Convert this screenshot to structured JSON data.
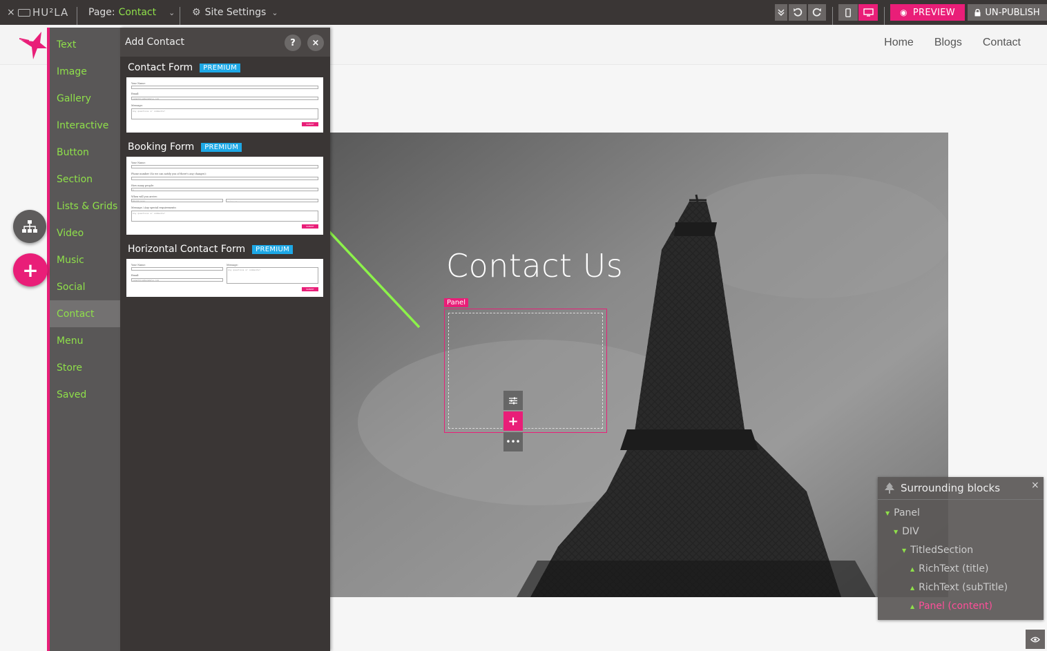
{
  "topbar": {
    "close": "×",
    "logo": "HU²LA",
    "page_label": "Page:",
    "page_value": "Contact",
    "site_settings": "Site Settings",
    "preview": "PREVIEW",
    "unpublish": "UN-PUBLISH",
    "chevron": "v"
  },
  "site": {
    "nav": [
      "Home",
      "Blogs",
      "Contact"
    ],
    "hero_title": "Contact Us",
    "panel_tag": "Panel"
  },
  "categories": {
    "items": [
      "Text",
      "Image",
      "Gallery",
      "Interactive",
      "Button",
      "Section",
      "Lists & Grids",
      "Video",
      "Music",
      "Social",
      "Contact",
      "Menu",
      "Store",
      "Saved"
    ],
    "active": "Contact"
  },
  "add_panel": {
    "title": "Add Contact",
    "help": "?",
    "close": "×",
    "badge": "PREMIUM",
    "sections": [
      {
        "title": "Contact Form"
      },
      {
        "title": "Booking Form"
      },
      {
        "title": "Horizontal Contact Form"
      }
    ],
    "form_labels": {
      "name": "Your Name:",
      "email": "Email:",
      "message": "Message:",
      "email_ph": "something@example.com",
      "message_ph": "Any questions or comments?",
      "phone": "Phone number (So we can notify you of there's any changes):",
      "people": "How many people:",
      "people_ph": "1",
      "arrive": "When will you arrive:",
      "date_ph": "mm/dd/yyyy",
      "time_ph": "--:-- --",
      "booking_msg": "Message / Any special requirements:",
      "submit": "SUBMIT"
    }
  },
  "surrounding": {
    "title": "Surrounding blocks",
    "close": "×",
    "items": [
      {
        "label": "Panel",
        "dir": "▼"
      },
      {
        "label": "DIV",
        "dir": "▼"
      },
      {
        "label": "TitledSection",
        "dir": "▼"
      },
      {
        "label": "RichText (title)",
        "dir": "▲"
      },
      {
        "label": "RichText (subTitle)",
        "dir": "▲"
      },
      {
        "label": "Panel (content)",
        "dir": "▲"
      }
    ]
  },
  "colors": {
    "accent": "#e91e78",
    "green": "#8fe04a",
    "premium": "#1da8e6",
    "dark": "#3a3635"
  }
}
